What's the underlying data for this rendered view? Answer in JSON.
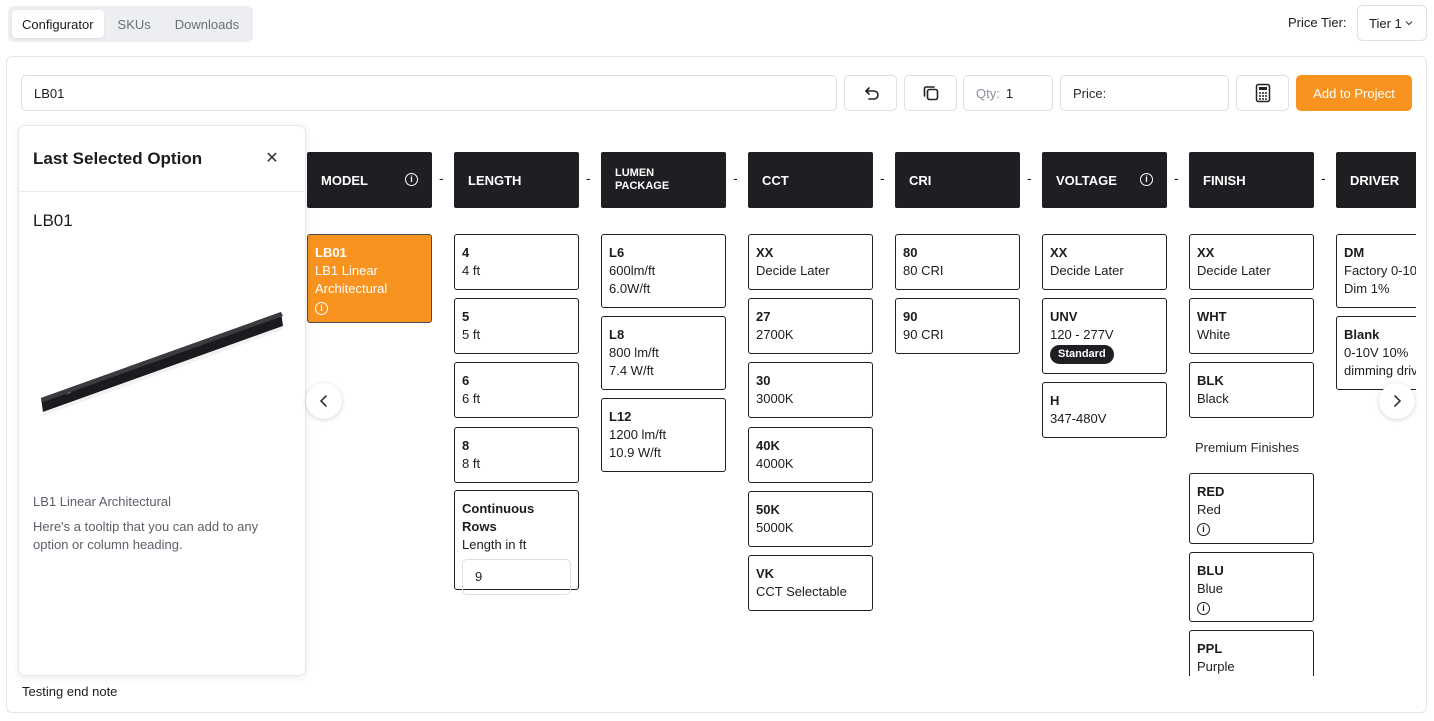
{
  "tabs": [
    "Configurator",
    "SKUs",
    "Downloads"
  ],
  "price_tier": {
    "label": "Price Tier:",
    "value": "Tier 1"
  },
  "toolbar": {
    "sku_value": "LB01",
    "qty_label": "Qty:",
    "qty_value": "1",
    "price_label": "Price:",
    "add_label": "Add to Project",
    "icons": [
      "undo-icon",
      "copy-icon",
      "calculator-icon"
    ]
  },
  "panel": {
    "title": "Last Selected Option",
    "code": "LB01",
    "name": "LB1 Linear Architectural",
    "description": "Here's a tooltip that you can add to any option or column heading."
  },
  "end_note": "Testing end note",
  "columns": {
    "model": {
      "heading": "MODEL",
      "options": [
        {
          "code": "LB01",
          "l1": "LB1 Linear",
          "l2": "Architectural"
        }
      ]
    },
    "length": {
      "heading": "LENGTH",
      "options": [
        {
          "code": "4",
          "l1": "4 ft"
        },
        {
          "code": "5",
          "l1": "5 ft"
        },
        {
          "code": "6",
          "l1": "6 ft"
        },
        {
          "code": "8",
          "l1": "8 ft"
        }
      ],
      "continuous": {
        "title": "Continuous Rows",
        "sub": "Length in ft",
        "value": "9"
      }
    },
    "lumen": {
      "heading_l1": "LUMEN",
      "heading_l2": "PACKAGE",
      "options": [
        {
          "code": "L6",
          "l1": "600lm/ft",
          "l2": "6.0W/ft"
        },
        {
          "code": "L8",
          "l1": "800 lm/ft",
          "l2": "7.4 W/ft"
        },
        {
          "code": "L12",
          "l1": "1200 lm/ft",
          "l2": "10.9 W/ft"
        }
      ]
    },
    "cct": {
      "heading": "CCT",
      "options": [
        {
          "code": "XX",
          "l1": "Decide Later"
        },
        {
          "code": "27",
          "l1": "2700K"
        },
        {
          "code": "30",
          "l1": "3000K"
        },
        {
          "code": "40K",
          "l1": "4000K"
        },
        {
          "code": "50K",
          "l1": "5000K"
        },
        {
          "code": "VK",
          "l1": "CCT Selectable"
        }
      ]
    },
    "cri": {
      "heading": "CRI",
      "options": [
        {
          "code": "80",
          "l1": "80 CRI"
        },
        {
          "code": "90",
          "l1": "90 CRI"
        }
      ]
    },
    "voltage": {
      "heading": "VOLTAGE",
      "options": [
        {
          "code": "XX",
          "l1": "Decide Later"
        },
        {
          "code": "UNV",
          "l1": "120 - 277V",
          "badge": "Standard"
        },
        {
          "code": "H",
          "l1": "347-480V"
        }
      ]
    },
    "finish": {
      "heading": "FINISH",
      "options": [
        {
          "code": "XX",
          "l1": "Decide Later"
        },
        {
          "code": "WHT",
          "l1": "White"
        },
        {
          "code": "BLK",
          "l1": "Black"
        }
      ],
      "premium_label": "Premium Finishes",
      "premium": [
        {
          "code": "RED",
          "l1": "Red"
        },
        {
          "code": "BLU",
          "l1": "Blue"
        },
        {
          "code": "PPL",
          "l1": "Purple"
        }
      ]
    },
    "driver": {
      "heading": "DRIVER",
      "options": [
        {
          "code": "DM",
          "l1": "Factory 0-10",
          "l2": "Dim 1%"
        },
        {
          "code": "Blank",
          "l1": "0-10V 10%",
          "l2": "dimming driv"
        }
      ]
    }
  },
  "colors": {
    "accent": "#f7931e",
    "header": "#1e1f23"
  }
}
